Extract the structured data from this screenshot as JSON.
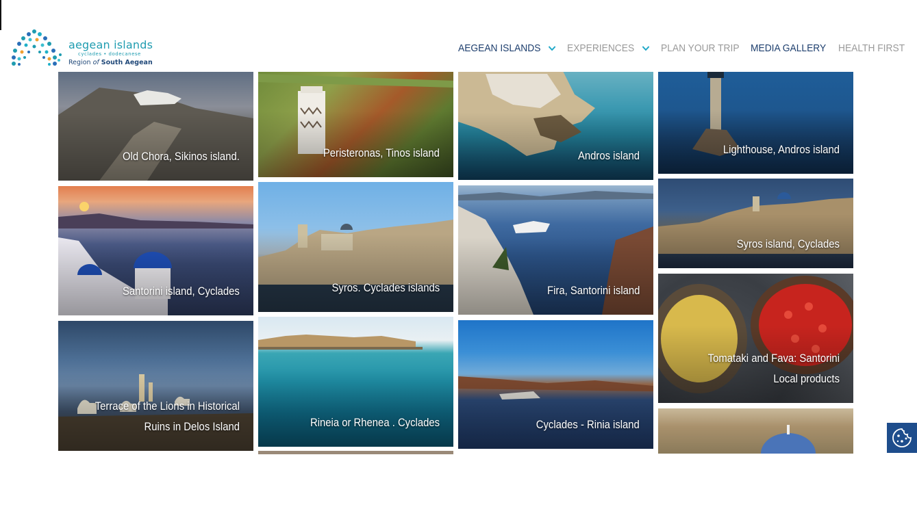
{
  "brand": {
    "title": "aegean islands",
    "subtitle": "cyclades • dodecanese",
    "region_prefix": "Region",
    "region_of": "of",
    "region_name": "South Aegean",
    "colors": {
      "teal": "#1f9cb0",
      "navy": "#1e3f6e",
      "blue": "#1e4d8c",
      "orange": "#f0a030"
    }
  },
  "nav": {
    "items": [
      {
        "label": "AEGEAN ISLANDS",
        "has_dropdown": true
      },
      {
        "label": "EXPERIENCES",
        "has_dropdown": true
      },
      {
        "label": "PLAN YOUR TRIP",
        "has_dropdown": false
      },
      {
        "label": "MEDIA GALLERY",
        "has_dropdown": false
      },
      {
        "label": "HEALTH FIRST",
        "has_dropdown": false
      }
    ]
  },
  "gallery": {
    "tiles": [
      {
        "caption": "Old Chora, Sikinos island."
      },
      {
        "caption": "Santorini island, Cyclades"
      },
      {
        "caption": "Terrace of the Lions in Historical Ruins in Delos Island"
      },
      {
        "caption": "Peristeronas, Tinos island"
      },
      {
        "caption": "Syros. Cyclades islands"
      },
      {
        "caption": "Rineia or Rhenea . Cyclades"
      },
      {
        "caption": "Andros island"
      },
      {
        "caption": "Fira, Santorini island"
      },
      {
        "caption": "Cyclades - Rinia island"
      },
      {
        "caption": "Lighthouse, Andros island"
      },
      {
        "caption": "Syros island, Cyclades"
      },
      {
        "caption": "Tomataki and Fava: Santorini Local products"
      },
      {
        "caption": ""
      },
      {
        "caption": ""
      }
    ]
  },
  "cookie": {
    "icon": "cookie-icon"
  }
}
